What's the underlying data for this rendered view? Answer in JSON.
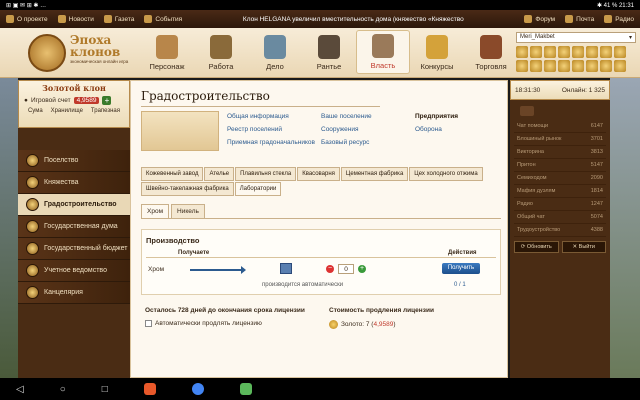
{
  "statusbar": {
    "left": "⊞ ▣ ✉ ⊞ ✱ …",
    "right": "✱ 41 % 21:31"
  },
  "topnav": {
    "items": [
      "О проекте",
      "Новости",
      "Газета",
      "События"
    ],
    "news": "Клон HELGANA увеличил вместительность дома (княжество «Княжество",
    "news_link": "дома",
    "right": [
      "Форум",
      "Почта",
      "Радио"
    ]
  },
  "logo": {
    "line1": "Эпоха",
    "line2": "клонов",
    "line3": "экономическая онлайн игра"
  },
  "mainnav": [
    {
      "label": "Персонаж",
      "color": "#b8864a"
    },
    {
      "label": "Работа",
      "color": "#8a6a3a"
    },
    {
      "label": "Дело",
      "color": "#6a8aa0"
    },
    {
      "label": "Рантье",
      "color": "#5a4a3a"
    },
    {
      "label": "Власть",
      "color": "#9a7a5a",
      "active": true
    },
    {
      "label": "Конкурсы",
      "color": "#d4a23a"
    },
    {
      "label": "Торговля",
      "color": "#8a4a2a"
    }
  ],
  "user": {
    "name": "Meri_Makbet"
  },
  "clan": {
    "title": "Золотой клон",
    "account_label": "Игровой счет",
    "account_value": "4,9589",
    "buildings": [
      "Сума",
      "Хранилище",
      "Трапезная"
    ]
  },
  "menu": [
    "Поселство",
    "Княжества",
    "Градостроительство",
    "Государственная дума",
    "Государственный бюджет",
    "Учетное ведомство",
    "Канцелярия"
  ],
  "page_title": "Градостроительство",
  "links": {
    "col1": [
      "Общая информация",
      "Реестр поселений",
      "Приемная градоначальников"
    ],
    "col2": [
      "Ваше поселение",
      "Сооружения",
      "Базовый ресурс"
    ],
    "col3": [
      "Предприятия",
      "Оборона"
    ]
  },
  "tabs": [
    "Кожевенный завод",
    "Ателье",
    "Плавильня стекла",
    "Квасоварня",
    "Цементная фабрика",
    "Цех холодного отжима",
    "Швейно-такелажная фабрика",
    "Лаборатории"
  ],
  "subtabs": [
    "Хром",
    "Никель"
  ],
  "production": {
    "title": "Производство",
    "col_receive": "Получаете",
    "col_action": "Действия",
    "resource": "Хром",
    "auto_text": "производится автоматически",
    "quantity": "0",
    "button": "Получить",
    "count": "0 / 1"
  },
  "license": {
    "days_text": "Осталось 728 дней до окончания срока лицензии",
    "cost_title": "Стоимость продления лицензии",
    "auto_renew": "Автоматически продлять лицензию",
    "cost_prefix": "Золото: 7 (",
    "cost_red": "4,9589",
    "cost_suffix": ")"
  },
  "right": {
    "time": "18:31:30",
    "online": "Онлайн: 1 325",
    "chat_rows": [
      {
        "name": "Чат помощи",
        "count": "6147"
      },
      {
        "name": "Блошиный рынок",
        "count": "3701"
      },
      {
        "name": "Викторина",
        "count": "3813"
      },
      {
        "name": "Притон",
        "count": "5147"
      },
      {
        "name": "Семиходом",
        "count": "2090"
      },
      {
        "name": "Мафия дуэлям",
        "count": "1814"
      },
      {
        "name": "Радио",
        "count": "1247"
      },
      {
        "name": "Общий чат",
        "count": "5074"
      },
      {
        "name": "Трудоустройство",
        "count": "4388"
      }
    ],
    "btn_refresh": "⟳ Обновить",
    "btn_exit": "✕ Выйти"
  }
}
